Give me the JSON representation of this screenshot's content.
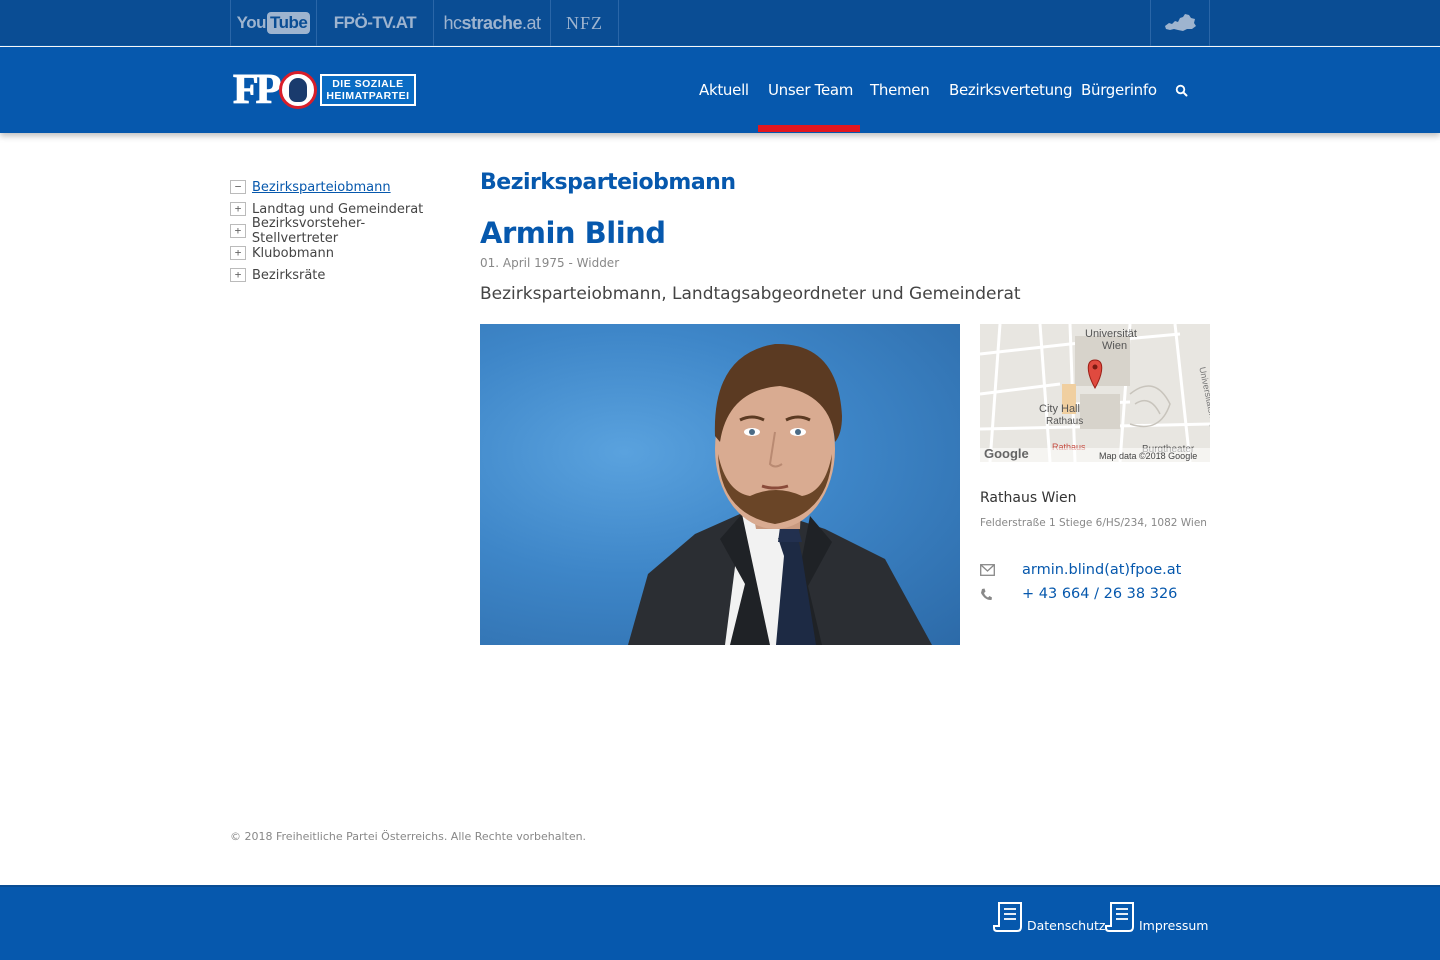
{
  "topbar": {
    "youtube": {
      "you": "You",
      "tube": "Tube"
    },
    "fpoetv": "FPÖ-TV.AT",
    "hc": {
      "pre": "hc",
      "mid": "strache",
      "post": ".at"
    },
    "nfz": "NFZ"
  },
  "logo": {
    "fp": "FP",
    "tag_line1": "DIE SOZIALE",
    "tag_line2": "HEIMATPARTEI"
  },
  "nav": {
    "items": [
      "Aktuell",
      "Unser Team",
      "Themen",
      "Bezirksvertetung",
      "Bürgerinfo"
    ],
    "active_index": 1
  },
  "sidebar": {
    "items": [
      {
        "label": "Bezirksparteiobmann",
        "expanded": true
      },
      {
        "label": "Landtag und Gemeinderat",
        "expanded": false
      },
      {
        "label": "Bezirksvorsteher-Stellvertreter",
        "expanded": false
      },
      {
        "label": "Klubobmann",
        "expanded": false
      },
      {
        "label": "Bezirksräte",
        "expanded": false
      }
    ],
    "minus_glyph": "−",
    "plus_glyph": "+"
  },
  "main": {
    "section_title": "Bezirksparteiobmann",
    "name": "Armin Blind",
    "dob": "01. April 1975 - Widder",
    "role": "Bezirksparteiobmann, Landtagsabgeordneter und Gemeinderat"
  },
  "map": {
    "label_university_1": "Universität",
    "label_university_2": "Wien",
    "label_cityhall_1": "City Hall",
    "label_cityhall_2": "Rathaus",
    "label_street": "Universitätsring",
    "label_burgtheater": "Burgtheater",
    "label_google": "Google",
    "attribution": "Map data ©2018 Google",
    "label_rathaus_u": "Rathaus"
  },
  "office": {
    "name": "Rathaus Wien",
    "address": "Felderstraße 1 Stiege 6/HS/234, 1082 Wien",
    "email": "armin.blind(at)fpoe.at",
    "phone": "+ 43 664 / 26 38 326"
  },
  "footer": {
    "copyright": "© 2018 Freiheitliche Partei Österreichs. Alle Rechte vorbehalten.",
    "links": [
      "Datenschutz",
      "Impressum"
    ]
  },
  "colors": {
    "brand_blue": "#0658ad",
    "topbar_blue": "#0a4d94",
    "accent_red": "#e3161d"
  }
}
